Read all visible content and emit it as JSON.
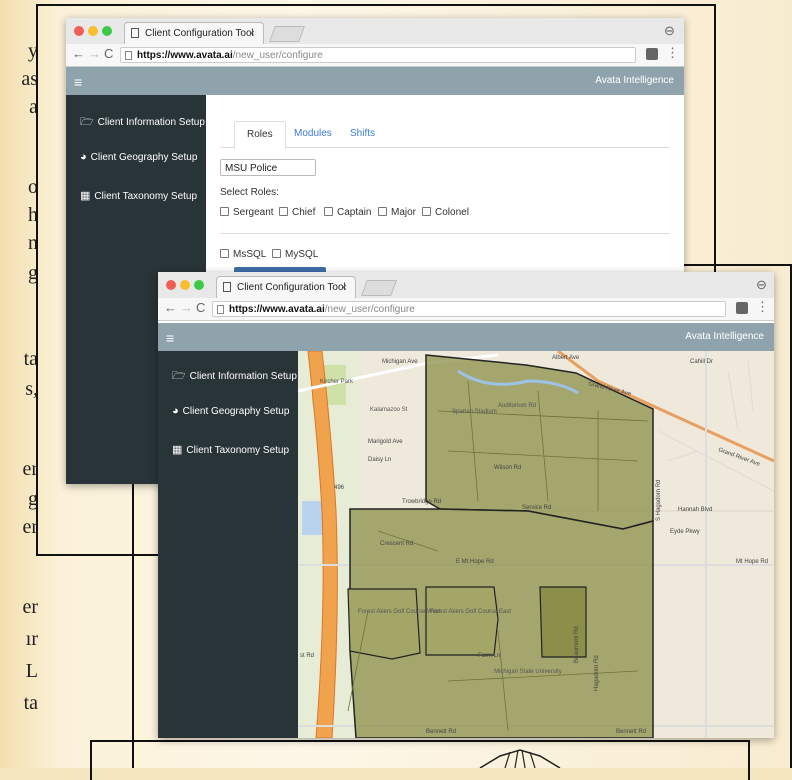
{
  "page_text_fragments": [
    "y",
    "as",
    "a",
    "o",
    "h",
    "n",
    "g",
    "ta",
    "s,",
    "er",
    "g",
    "er",
    "er",
    "ır",
    "L",
    "ta"
  ],
  "window_back": {
    "tab_title": "Client Configuration Tool",
    "tab_close": "×",
    "url_domain": "https://www.avata.ai",
    "url_path": "/new_user/configure",
    "brand": "Avata Intelligence",
    "sidebar": [
      {
        "icon": "folder-icon",
        "glyph": "🗁",
        "label": "Client Information Setup"
      },
      {
        "icon": "globe-icon",
        "glyph": "◕",
        "label": "Client Geography Setup"
      },
      {
        "icon": "grid-icon",
        "glyph": "▦",
        "label": "Client Taxonomy Setup"
      }
    ],
    "tabs": [
      "Roles",
      "Modules",
      "Shifts"
    ],
    "client_name_value": "MSU Police",
    "select_roles_label": "Select Roles:",
    "roles": [
      "Sergeant",
      "Chief",
      "Captain",
      "Major",
      "Colonel"
    ],
    "databases": [
      "MsSQL",
      "MySQL"
    ]
  },
  "window_front": {
    "tab_title": "Client Configuration Tool",
    "tab_close": "×",
    "url_domain": "https://www.avata.ai",
    "url_path": "/new_user/configure",
    "brand": "Avata Intelligence",
    "sidebar": [
      {
        "icon": "folder-icon",
        "glyph": "🗁",
        "label": "Client Information Setup"
      },
      {
        "icon": "globe-icon",
        "glyph": "◕",
        "label": "Client Geography Setup"
      },
      {
        "icon": "grid-icon",
        "glyph": "▦",
        "label": "Client Taxonomy Setup"
      }
    ],
    "map_labels": {
      "michigan_ave": "Michigan Ave",
      "albert_ave": "Albert Ave",
      "grand_river": "Grand River Ave",
      "grand_river_e": "Grand River Ave",
      "cahill": "Cahill Dr",
      "auditorium": "Auditorium Rd",
      "kalamazoo": "Kalamazoo St",
      "spartan": "Spartan Stadium",
      "kircher": "Kircher Park",
      "marigold": "Marigold Ave",
      "daisy": "Daisy Ln",
      "wilson": "Wilson Rd",
      "trowbridge": "Trowbridge Rd",
      "service": "Service Rd",
      "hannah": "Hannah Blvd",
      "eyde": "Eyde Pkwy",
      "crescent": "Crescent Rd",
      "mt_hope": "E Mt Hope Rd",
      "mt_hope_e": "Mt Hope Rd",
      "golf_west": "Forest Akers Golf Course West",
      "golf_east": "Forest Akers Golf Course East",
      "msu": "Michigan State University",
      "farm_lane": "Farm Ln",
      "bennett": "Bennett Rd",
      "bennett_e": "Bennett Rd",
      "hagadorn": "Hagadorn Rd",
      "hagadorn_s": "S Hagadorn Rd",
      "beaumont": "Beaumont Rd",
      "rd_left": "st Rd",
      "interstate": "496"
    }
  },
  "colors": {
    "sidebar": "#293438",
    "appbar": "#8fa3ad",
    "region": "#8c8f4a",
    "accent": "#3a7bd5"
  }
}
